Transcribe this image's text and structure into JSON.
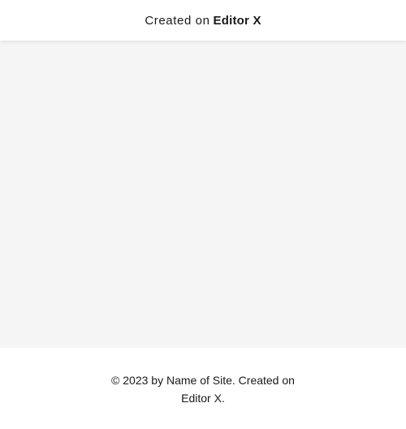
{
  "banner": {
    "prefix": "Created on",
    "brand": "Editor X"
  },
  "footer": {
    "line1": "© 2023 by Name of Site. Created on",
    "line2": "Editor X."
  },
  "colors": {
    "banner_bg": "#ffffff",
    "content_bg": "#f5f5f5",
    "footer_bg": "#ffffff",
    "text": "#1a1a1a"
  }
}
